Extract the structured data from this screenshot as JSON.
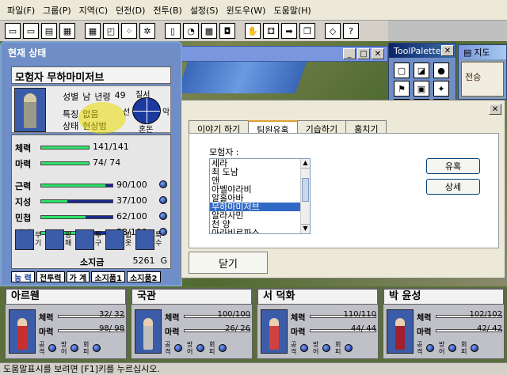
{
  "menu": [
    "파일(F)",
    "그룹(P)",
    "지역(C)",
    "던전(D)",
    "전투(B)",
    "설정(S)",
    "윈도우(W)",
    "도움말(H)"
  ],
  "toolbar_icons": [
    "window-icon",
    "window-icon",
    "map-icon",
    "tile-icon",
    "tile-icon",
    "shape-icon",
    "pattern-icon",
    "gear-icon",
    "rect-icon",
    "round-icon",
    "grid-icon",
    "bucket-icon",
    "hand-icon",
    "dice-icon",
    "arrow-icon",
    "copy-icon",
    "eraser-icon",
    "help-icon"
  ],
  "status_window": {
    "title": "현재 상태",
    "name": "모험자 무하마미저브",
    "gender_label": "성별",
    "gender": "남",
    "age_label": "년령",
    "age": "49",
    "trait_label": "특징",
    "trait": "없음",
    "state_label": "상태",
    "state": "현상범",
    "alignment_top": "질서",
    "alignment_left": "선",
    "alignment_right": "악",
    "alignment_bottom": "혼돈",
    "stats": [
      {
        "label": "체력",
        "value": "141/141",
        "fill": 1.0
      },
      {
        "label": "마력",
        "value": "74/ 74",
        "fill": 1.0
      },
      {
        "label": "근력",
        "value": "90/100",
        "fill": 0.9
      },
      {
        "label": "지성",
        "value": "37/100",
        "fill": 0.37
      },
      {
        "label": "민첩",
        "value": "62/100",
        "fill": 0.62
      },
      {
        "label": "매력",
        "value": "53/100",
        "fill": 0.53
      }
    ],
    "equip_labels": [
      "무기",
      "방패",
      "투구",
      "갑옷",
      "특수"
    ],
    "gold_label": "소지금",
    "gold": "5261",
    "gold_unit": "G",
    "tabs": [
      "능 력",
      "전투력",
      "가 계",
      "소지품1",
      "소지품2"
    ]
  },
  "minimap_title": "지도",
  "minimap_text": "전승",
  "tool_palette_title": "ToolPalette",
  "dialog": {
    "tabs": [
      "이야기 하기",
      "팀원유혹",
      "기습하기",
      "훔치기"
    ],
    "active_tab": 1,
    "list_label": "모험자 :",
    "list_items": [
      "세라",
      "최 도남",
      "앤",
      "아벨야라비",
      "알홀아바",
      "무하마미저브",
      "알라사민",
      "천 양",
      "아라비르파스"
    ],
    "selected_index": 5,
    "btn_seduce": "유혹",
    "btn_detail": "상세",
    "btn_close": "닫기"
  },
  "party": [
    {
      "name": "아르웬",
      "hp": "32/ 32",
      "mp": "98/ 98",
      "fill_hp": 1.0,
      "fill_mp": 1.0,
      "color": "#c83030"
    },
    {
      "name": "국관",
      "hp": "100/100",
      "mp": "26/ 26",
      "fill_hp": 1.0,
      "fill_mp": 1.0,
      "color": "#c0c0c0"
    },
    {
      "name": "서 덕화",
      "hp": "110/110",
      "mp": "44/ 44",
      "fill_hp": 1.0,
      "fill_mp": 1.0,
      "color": "#d04040"
    },
    {
      "name": "박 윤성",
      "hp": "102/102",
      "mp": "42/ 42",
      "fill_hp": 1.0,
      "fill_mp": 1.0,
      "color": "#a02030"
    }
  ],
  "party_labels": {
    "hp": "체력",
    "mp": "마력",
    "attack": "공격",
    "defense": "방어",
    "avoid": "회피"
  },
  "statusbar": "도움말표시를 보려면 [F1]키를 누르십시오."
}
